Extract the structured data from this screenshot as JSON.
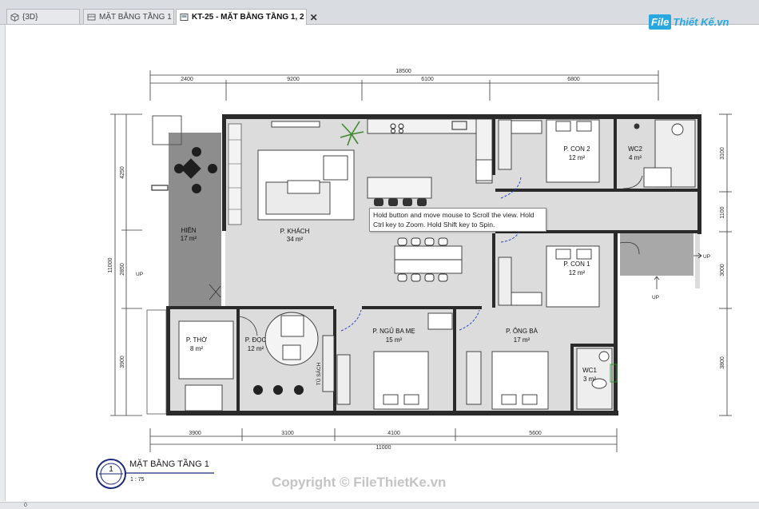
{
  "tabs": [
    {
      "label": "{3D}",
      "icon": "cube-icon",
      "active": false
    },
    {
      "label": "MẶT BẰNG TẦNG 1",
      "icon": "plan-view-icon",
      "active": false
    },
    {
      "label": "KT-25 - MẶT BẰNG TẦNG 1, 2",
      "icon": "sheet-icon",
      "active": true
    }
  ],
  "tab_close": "✕",
  "logo": {
    "file": "File",
    "rest": "Thiết Kế.vn",
    "brand_color": "#29a7e1"
  },
  "tooltip": "Hold button and move mouse to Scroll the view. Hold Ctrl key to Zoom. Hold Shift key to Spin.",
  "view_title": {
    "number": "1",
    "name": "MẶT BẰNG TẦNG 1",
    "scale": "1 : 75"
  },
  "watermark": "Copyright © FileThietKe.vn",
  "bottom_bar": {
    "left": "0"
  },
  "rooms": [
    {
      "name": "HIÊN",
      "area": "17 m²"
    },
    {
      "name": "P. KHÁCH",
      "area": "34 m²"
    },
    {
      "name": "P. CON 2",
      "area": "12 m²"
    },
    {
      "name": "WC2",
      "area": "4 m²"
    },
    {
      "name": "P. CON 1",
      "area": "12 m²"
    },
    {
      "name": "P. THỜ",
      "area": "8 m²"
    },
    {
      "name": "P. ĐỌC",
      "area": "12 m²"
    },
    {
      "name": "P. NGỦ BA MẸ",
      "area": "15 m²"
    },
    {
      "name": "P. ÔNG BÀ",
      "area": "17 m²"
    },
    {
      "name": "WC1",
      "area": "3 m²"
    }
  ],
  "labels": {
    "tu_sach": "TỦ SÁCH",
    "up": "UP"
  },
  "dimensions": {
    "top_total": "18500",
    "top_segments": [
      "2400",
      "9200",
      "6100",
      "6800"
    ],
    "bottom_total": "11000",
    "bottom_segments": [
      "3900",
      "3100",
      "4100",
      "5600"
    ],
    "left_total": "11000",
    "left_segments": [
      "4250",
      "2850",
      "3900"
    ],
    "right_segments": [
      "3100",
      "1100",
      "3000",
      "3800"
    ]
  },
  "colors": {
    "wall": "#2a2a2a",
    "floor": "#dcdcdc",
    "porch": "#8d8d8d",
    "dim": "#3a3a3a"
  }
}
